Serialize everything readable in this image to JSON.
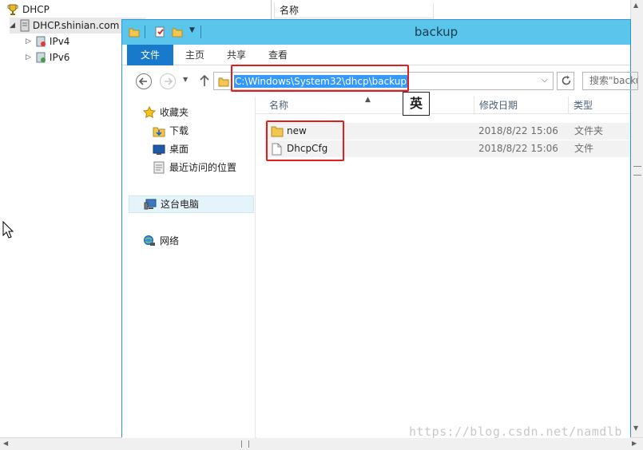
{
  "console": {
    "tree": {
      "root": "DHCP",
      "server": "DHCP.shinian.com",
      "ipv4": "IPv4",
      "ipv6": "IPv6"
    },
    "list_header": "名称"
  },
  "explorer": {
    "title": "backup",
    "ribbon_tabs": [
      "文件",
      "主页",
      "共享",
      "查看"
    ],
    "address": "C:\\Windows\\System32\\dhcp\\backup",
    "search_placeholder": "搜索\"backup\"",
    "ime_indicator": "英",
    "nav": {
      "favorites": "收藏夹",
      "downloads": "下载",
      "desktop": "桌面",
      "recent": "最近访问的位置",
      "this_pc": "这台电脑",
      "network": "网络"
    },
    "columns": [
      "名称",
      "修改日期",
      "类型"
    ],
    "files": [
      {
        "name": "new",
        "modified": "2018/8/22 15:06",
        "type": "文件夹",
        "icon": "folder-icon"
      },
      {
        "name": "DhcpCfg",
        "modified": "2018/8/22 15:06",
        "type": "文件",
        "icon": "file-icon"
      }
    ]
  },
  "watermark": "https://blog.csdn.net/namdlb",
  "colors": {
    "titlebar": "#5bc5eb",
    "file_tab": "#1979ca",
    "selection": "#3399ff",
    "highlight": "#e51c1c"
  }
}
